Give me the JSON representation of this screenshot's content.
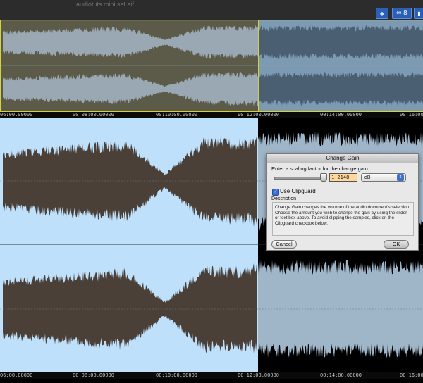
{
  "window": {
    "title": "audiotuts mini set.aif"
  },
  "toolbar": {
    "buttons": [
      {
        "name": "play-selection",
        "icon": "diamond-arrows-icon"
      },
      {
        "name": "loop",
        "icon": "infinity-icon"
      },
      {
        "name": "cue",
        "icon": "bookmark-icon"
      }
    ]
  },
  "timeline": {
    "labels": [
      "06:00.00000",
      "00:08:00.00000",
      "00:10:00.00000",
      "00:12:00.00000",
      "00:14:00.00000",
      "00:16:00.0"
    ]
  },
  "dialog": {
    "title": "Change Gain",
    "prompt": "Enter a scaling factor for the change gain:",
    "gain_value": "1.2148",
    "unit": "dB",
    "clipguard_label": "Use Clipguard",
    "clipguard_checked": true,
    "description_heading": "Description",
    "description": "Change Gain changes the volume of the audio document's selection.  Choose the amount you wish to change the gain by using the slider or text box above.  To avoid clipping the samples, click on the Clipguard checkbox below.",
    "cancel_label": "Cancel",
    "ok_label": "OK"
  },
  "colors": {
    "selection_main": "#bfe0fb",
    "waveform_selected": "#4a4038",
    "waveform_unselected_main": "#9fb5c8",
    "overview_selected_bg": "#5c5a48",
    "overview_wave": "#9aa8b4",
    "overview_unselected_bg": "#7d9ab3",
    "overview_unselected_wave": "#4b5f72",
    "selection_border": "#d8d23a"
  }
}
